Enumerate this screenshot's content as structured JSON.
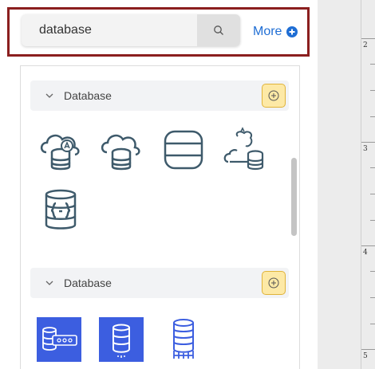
{
  "search": {
    "value": "database",
    "search_icon": "search-icon"
  },
  "more": {
    "label": "More",
    "icon": "plus-circle-icon"
  },
  "sections": [
    {
      "title": "Database",
      "icons": [
        "cloud-database-refresh-icon",
        "cloud-database-icon",
        "database-icon",
        "mysql-cloud-database-icon",
        "json-database-icon"
      ]
    },
    {
      "title": "Database",
      "icons": [
        "aws-database-migration-icon",
        "aws-database-icon",
        "database-server-icon"
      ]
    }
  ],
  "ruler": {
    "numbers": [
      "2",
      "3",
      "4",
      "5"
    ]
  },
  "colors": {
    "accent": "#1f6ed4",
    "highlight_border": "#8b1f1f",
    "icon_stroke": "#3e5a6b",
    "aws_blue": "#3c5ee0",
    "add_button": "#fde9a6"
  }
}
